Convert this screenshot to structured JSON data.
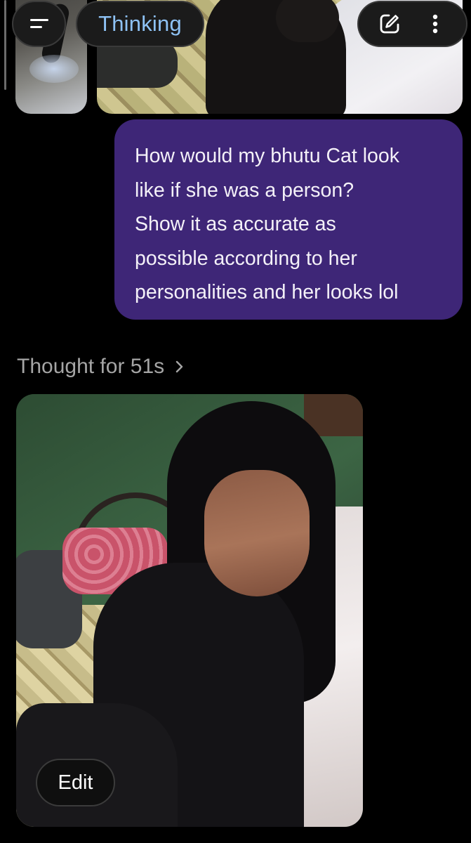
{
  "header": {
    "menu_icon": "menu-icon",
    "mode_label": "Thinking",
    "new_chat_icon": "edit-square-icon",
    "more_icon": "more-vertical-icon"
  },
  "conversation": {
    "user_message": {
      "lines": [
        "How would my bhutu Cat look",
        "like if she was a person?",
        "Show it as accurate as",
        "possible according to her",
        "personalities and her looks lol"
      ]
    },
    "assistant": {
      "thought_label": "Thought for 51s",
      "thought_chevron_icon": "chevron-right-icon",
      "image_edit_label": "Edit"
    }
  },
  "colors": {
    "background": "#000000",
    "user_bubble": "#3e2677",
    "mode_text": "#8ec2f5",
    "muted_text": "#a5a5a5"
  }
}
